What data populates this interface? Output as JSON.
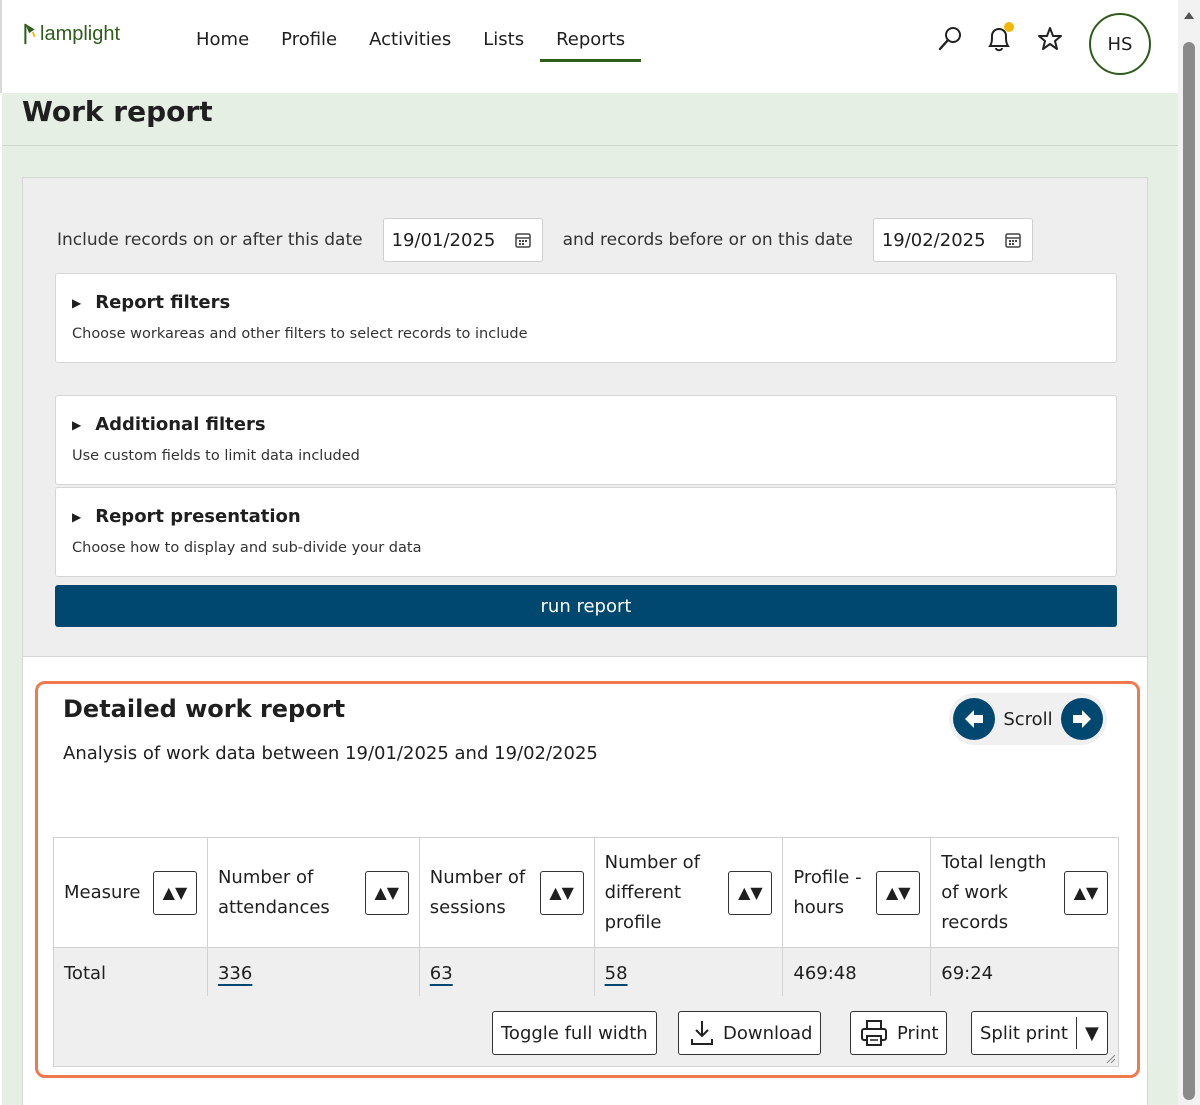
{
  "app": {
    "logo_text": "lamplight",
    "nav": [
      {
        "label": "Home"
      },
      {
        "label": "Profile"
      },
      {
        "label": "Activities"
      },
      {
        "label": "Lists"
      },
      {
        "label": "Reports",
        "active": true
      }
    ],
    "icons": [
      "search-icon",
      "bell-icon",
      "star-icon"
    ],
    "avatar_initials": "HS",
    "colors": {
      "brand_green": "#2e5c1a",
      "primary_blue": "#00486f",
      "highlight": "#ef7a4d",
      "notification": "#f2b705",
      "page_bg": "#e6efe4"
    }
  },
  "page": {
    "title": "Work report",
    "date_from_label": "Include records on or after this date",
    "date_from_value": "19/01/2025",
    "date_to_label": "and records before or on this date",
    "date_to_value": "19/02/2025",
    "sections": [
      {
        "title": "Report filters",
        "subtitle": "Choose workareas and other filters to select records to include"
      },
      {
        "title": "Additional filters",
        "subtitle": "Use custom fields to limit data included"
      },
      {
        "title": "Report presentation",
        "subtitle": "Choose how to display and sub-divide your data"
      }
    ],
    "run_button": "run report"
  },
  "report": {
    "title": "Detailed work report",
    "subtitle": "Analysis of work data between 19/01/2025 and 19/02/2025",
    "scroll_label": "Scroll",
    "columns": [
      "Measure",
      "Number of attendances",
      "Number of sessions",
      "Number of different profile",
      "Profile - hours",
      "Total length of work records"
    ],
    "sort_glyph": "▲▼",
    "rows": [
      {
        "measure": "Total",
        "attendances": "336",
        "sessions": "63",
        "different_profile": "58",
        "profile_hours": "469:48",
        "total_length": "69:24"
      }
    ],
    "buttons": {
      "toggle_width": "Toggle full width",
      "download": "Download",
      "print": "Print",
      "split_print": "Split print",
      "split_arrow": "▼"
    }
  }
}
